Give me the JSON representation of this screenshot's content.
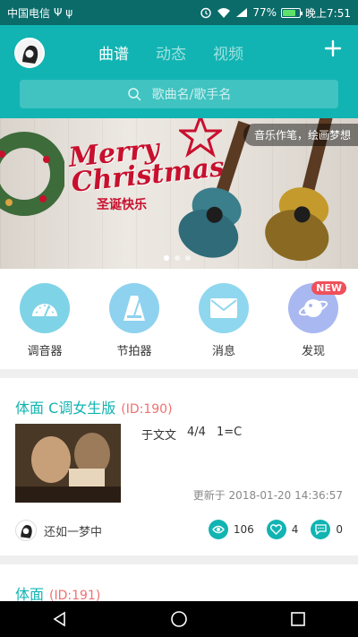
{
  "status": {
    "carrier": "中国电信",
    "battery": "77%",
    "battery_level": 0.77,
    "time": "晚上7:51"
  },
  "header": {
    "tabs": [
      {
        "label": "曲谱",
        "active": true
      },
      {
        "label": "动态",
        "active": false
      },
      {
        "label": "视频",
        "active": false
      }
    ],
    "search_placeholder": "歌曲名/歌手名",
    "accent": "#11b4b2"
  },
  "banner": {
    "tag": "音乐作笔，绘画梦想",
    "title_line1": "Merry",
    "title_line2": "Christmas",
    "subtitle": "圣诞快乐",
    "slides": 3,
    "active_slide": 1
  },
  "tools": [
    {
      "label": "调音器",
      "icon": "tuner-icon",
      "color": "#7fd3e6"
    },
    {
      "label": "节拍器",
      "icon": "metronome-icon",
      "color": "#8fd2ef"
    },
    {
      "label": "消息",
      "icon": "message-icon",
      "color": "#8fd7ee"
    },
    {
      "label": "发现",
      "icon": "planet-icon",
      "color": "#a9b8f0",
      "badge": "NEW"
    }
  ],
  "cards": [
    {
      "title": "体面 C调女生版",
      "id": "(ID:190)",
      "artist": "于文文",
      "time_sig": "4/4",
      "key": "1=C",
      "updated": "更新于 2018-01-20 14:36:57",
      "author": "还如一梦中",
      "views": "106",
      "likes": "4",
      "comments": "0"
    },
    {
      "title": "体面",
      "id": "(ID:191)"
    }
  ]
}
